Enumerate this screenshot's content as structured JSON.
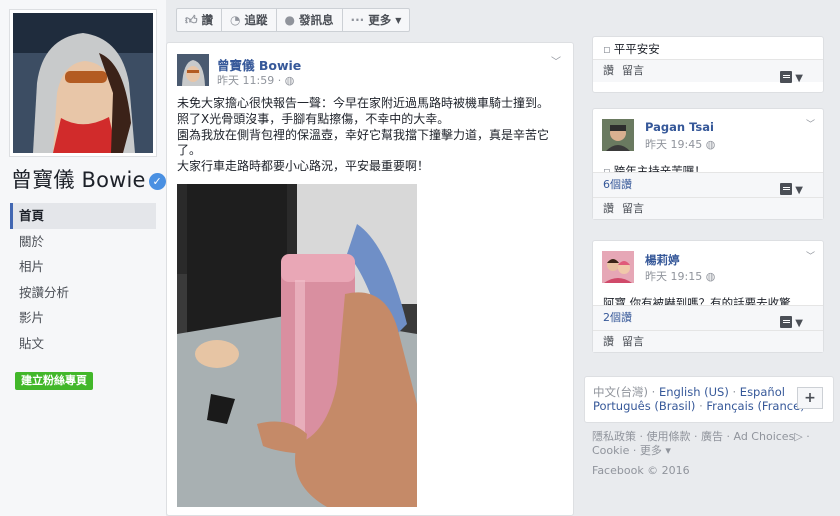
{
  "colors": {
    "link": "#365899",
    "accent": "#4267b2",
    "create_btn": "#42b72a",
    "verified": "#4a90e2"
  },
  "page": {
    "name": "曾寶儀 Bowie",
    "verified_icon": "verified-check-icon"
  },
  "nav": {
    "items": [
      "首頁",
      "關於",
      "相片",
      "按讚分析",
      "影片",
      "貼文"
    ],
    "active_index": 0
  },
  "create_page_button": "建立粉絲專頁",
  "action_bar": {
    "like": {
      "icon": "thumbs-up-icon",
      "label": "讚"
    },
    "follow": {
      "icon": "rss-icon",
      "label": "追蹤"
    },
    "message": {
      "icon": "message-icon",
      "label": "發訊息"
    },
    "more": {
      "icon": "ellipsis-icon",
      "label": "更多"
    }
  },
  "post": {
    "author": "曾寶儀 Bowie",
    "time": "昨天 11:59",
    "privacy_icon": "globe-icon",
    "text_lines": [
      "未免大家擔心很快報告一聲：今早在家附近過馬路時被機車騎士撞到。",
      "照了X光骨頭沒事，手腳有點擦傷，不幸中的大幸。",
      "園為我放在側背包裡的保溫壺，幸好它幫我擋下撞擊力道，真是辛苦它了。",
      "大家行車走路時都要小心路況，平安最重要啊！"
    ]
  },
  "comments": [
    {
      "author": "",
      "time": "",
      "text": "平平安安",
      "count": "",
      "like": "讚",
      "reply": "留言"
    },
    {
      "author": "Pagan Tsai",
      "time": "昨天 19:45",
      "text": "跨年主持辛苦囉！",
      "count": "6個讚",
      "like": "讚",
      "reply": "留言"
    },
    {
      "author": "楊莉婷",
      "time": "昨天 19:15",
      "text": "阿寶 你有被嚇到嗎？有的話要去收驚喔！",
      "count": "2個讚",
      "like": "讚",
      "reply": "留言"
    }
  ],
  "languages": {
    "current": "中文(台灣)",
    "links": [
      "English (US)",
      "Español",
      "Português (Brasil)",
      "Français (France)"
    ]
  },
  "footer": {
    "links": [
      "隱私政策",
      "使用條款",
      "廣告",
      "Ad Choices",
      "Cookie",
      "更多"
    ],
    "copyright": "Facebook © 2016"
  }
}
